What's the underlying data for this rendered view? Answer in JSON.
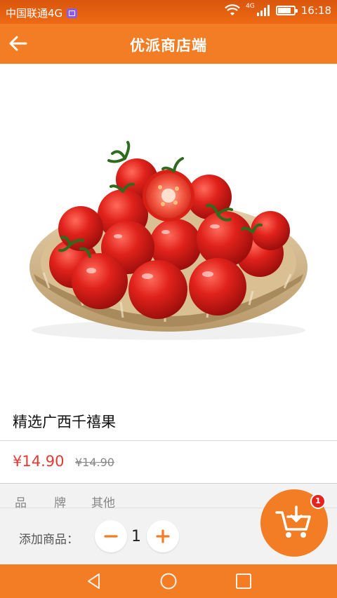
{
  "status_bar": {
    "carrier": "中国联通4G",
    "network": "4G",
    "time": "16:18"
  },
  "header": {
    "title": "优派商店端"
  },
  "product": {
    "name": "精选广西千禧果",
    "price": "¥14.90",
    "original_price": "¥14.90"
  },
  "tabs": [
    {
      "label": "品"
    },
    {
      "label": "牌"
    },
    {
      "label": "其他"
    }
  ],
  "add_to_cart": {
    "label": "添加商品：",
    "quantity": "1"
  },
  "cart": {
    "badge_count": "1"
  },
  "colors": {
    "primary": "#f27d24",
    "price": "#e53935",
    "badge": "#e52420"
  }
}
